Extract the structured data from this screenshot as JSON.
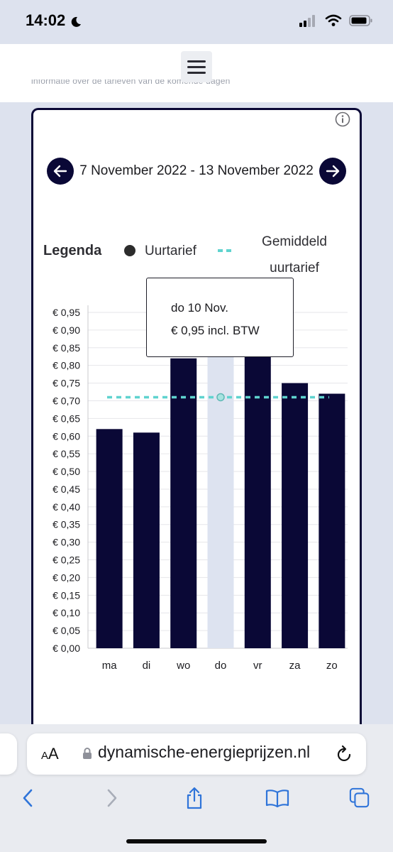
{
  "status_bar": {
    "time": "14:02"
  },
  "header": {
    "ghost_text": "informatie over de tarieven van de komende dagen"
  },
  "card": {
    "date_range": "7 November 2022 - 13 November 2022",
    "legend": {
      "title": "Legenda",
      "item_hourly": "Uurtarief",
      "item_average": "Gemiddeld uurtarief"
    },
    "tooltip": {
      "date": "do 10 Nov.",
      "value": "€ 0,95 incl. BTW"
    }
  },
  "chart_data": {
    "type": "bar",
    "categories": [
      "ma",
      "di",
      "wo",
      "do",
      "vr",
      "za",
      "zo"
    ],
    "series": [
      {
        "name": "Uurtarief",
        "values": [
          0.62,
          0.61,
          0.82,
          0.95,
          0.84,
          0.75,
          0.72
        ]
      }
    ],
    "average_line": {
      "name": "Gemiddeld uurtarief",
      "value": 0.71
    },
    "highlighted_category": "do",
    "y_ticks": [
      "€ 0,00",
      "€ 0,05",
      "€ 0,10",
      "€ 0,15",
      "€ 0,20",
      "€ 0,25",
      "€ 0,30",
      "€ 0,35",
      "€ 0,40",
      "€ 0,45",
      "€ 0,50",
      "€ 0,55",
      "€ 0,60",
      "€ 0,65",
      "€ 0,70",
      "€ 0,75",
      "€ 0,80",
      "€ 0,85",
      "€ 0,90",
      "€ 0,95"
    ],
    "ylim": [
      0,
      0.95
    ],
    "grid": true,
    "colors": {
      "bar": "#0a0836",
      "highlight": "#dde3f0",
      "average": "#5fd3cf"
    }
  },
  "browser": {
    "aa_label": "AA",
    "url": "dynamische-energieprijzen.nl"
  }
}
